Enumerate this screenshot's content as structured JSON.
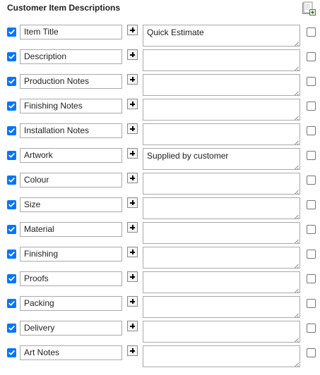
{
  "panel": {
    "title": "Customer Item Descriptions",
    "add_icon": "add-panel-icon"
  },
  "rows": [
    {
      "label": "Item Title",
      "value": "Quick Estimate",
      "included": true,
      "flagged": false
    },
    {
      "label": "Description",
      "value": "",
      "included": true,
      "flagged": false
    },
    {
      "label": "Production Notes",
      "value": "",
      "included": true,
      "flagged": false
    },
    {
      "label": "Finishing Notes",
      "value": "",
      "included": true,
      "flagged": false
    },
    {
      "label": "Installation Notes",
      "value": "",
      "included": true,
      "flagged": false
    },
    {
      "label": "Artwork",
      "value": "Supplied by customer",
      "included": true,
      "flagged": false
    },
    {
      "label": "Colour",
      "value": "",
      "included": true,
      "flagged": false
    },
    {
      "label": "Size",
      "value": "",
      "included": true,
      "flagged": false
    },
    {
      "label": "Material",
      "value": "",
      "included": true,
      "flagged": false
    },
    {
      "label": "Finishing",
      "value": "",
      "included": true,
      "flagged": false
    },
    {
      "label": "Proofs",
      "value": "",
      "included": true,
      "flagged": false
    },
    {
      "label": "Packing",
      "value": "",
      "included": true,
      "flagged": false
    },
    {
      "label": "Delivery",
      "value": "",
      "included": true,
      "flagged": false
    },
    {
      "label": "Art Notes",
      "value": "",
      "included": true,
      "flagged": false
    }
  ],
  "colors": {
    "checkbox_checked": "#0075ff",
    "border": "#a9a9a9"
  }
}
